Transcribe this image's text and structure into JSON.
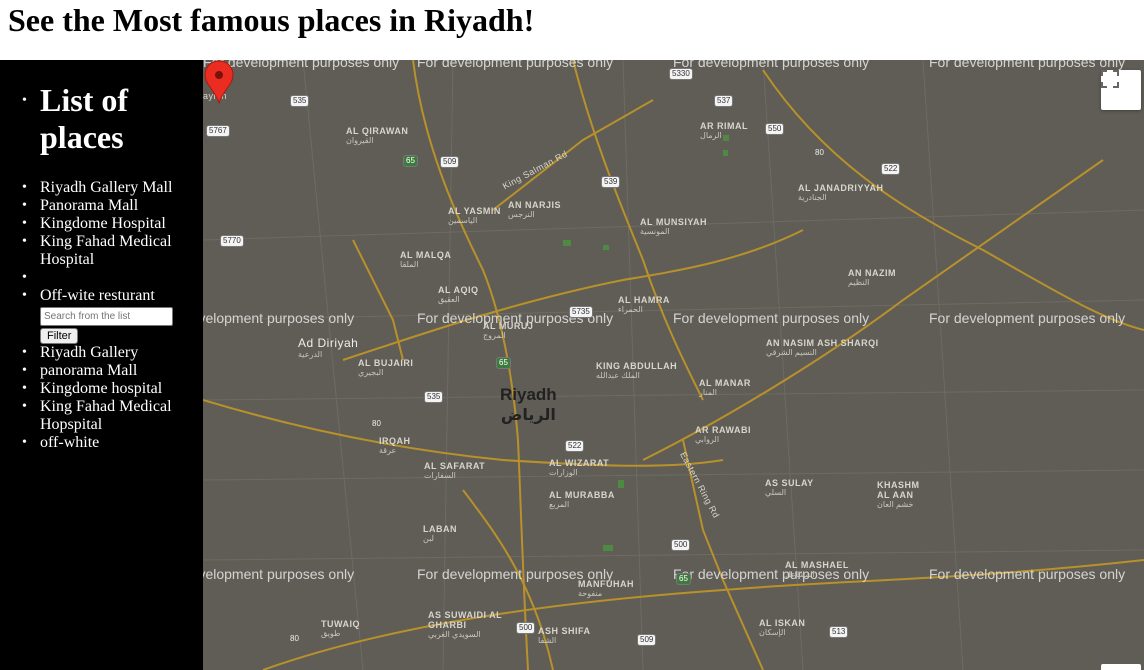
{
  "page": {
    "title": "See the Most famous places in Riyadh!"
  },
  "sidebar": {
    "heading": "List of places",
    "places": [
      "Riyadh Gallery Mall",
      "Panorama Mall",
      "Kingdome Hospital",
      "King Fahad Medical Hospital",
      "",
      "Off-wite resturant"
    ],
    "search_placeholder": "Search from the list",
    "filter_label": "Filter",
    "results": [
      "Riyadh Gallery",
      "panorama Mall",
      "Kingdome hospital",
      "King Fahad Medical Hopspital",
      "off-white"
    ]
  },
  "map": {
    "watermark": "For development purposes only",
    "city_en": "Riyadh",
    "city_ar": "الرياض",
    "districts": [
      {
        "en": "AL QIRAWAN",
        "ar": "القيروان"
      },
      {
        "en": "AN NARJIS",
        "ar": "النرجس"
      },
      {
        "en": "AL YASMIN",
        "ar": "الياسمين"
      },
      {
        "en": "AR RIMAL",
        "ar": "الرمال"
      },
      {
        "en": "AL JANADRIYYAH",
        "ar": "الجنادرية"
      },
      {
        "en": "AL MUNSIYAH",
        "ar": "المونسية"
      },
      {
        "en": "AL MALQA",
        "ar": "الملقا"
      },
      {
        "en": "AL AQIQ",
        "ar": "العقيق"
      },
      {
        "en": "AL HAMRA",
        "ar": "الحمراء"
      },
      {
        "en": "AN NAZIM",
        "ar": "النظيم"
      },
      {
        "en": "AL MURUJ",
        "ar": "المروج"
      },
      {
        "en": "Ad Diriyah",
        "ar": "الدرعية"
      },
      {
        "en": "AN NASIM ASH SHARQI",
        "ar": "النسيم الشرقي"
      },
      {
        "en": "AL BUJAIRI",
        "ar": "البجيري"
      },
      {
        "en": "KING ABDULLAH",
        "ar": "الملك عبدالله"
      },
      {
        "en": "AL MANAR",
        "ar": "المنار"
      },
      {
        "en": "IRQAH",
        "ar": "عرقة"
      },
      {
        "en": "AR RAWABI",
        "ar": "الروابي"
      },
      {
        "en": "AL SAFARAT",
        "ar": "السفارات"
      },
      {
        "en": "AL WIZARAT",
        "ar": "الوزارات"
      },
      {
        "en": "AS SULAY",
        "ar": "السلي"
      },
      {
        "en": "KHASHM AL AAN",
        "ar": "خشم العان"
      },
      {
        "en": "AL MURABBA",
        "ar": "المربع"
      },
      {
        "en": "LABAN",
        "ar": "لبن"
      },
      {
        "en": "AL MASHAEL",
        "ar": "المشاعل"
      },
      {
        "en": "MANFUHAH",
        "ar": "منفوحة"
      },
      {
        "en": "AS SUWAIDI AL GHARBI",
        "ar": "السويدي الغربي"
      },
      {
        "en": "TUWAIQ",
        "ar": "طويق"
      },
      {
        "en": "ASH SHIFA",
        "ar": "الشفا"
      },
      {
        "en": "AL ISKAN",
        "ar": "الإسكان"
      },
      {
        "en": "aylah",
        "ar": ""
      }
    ],
    "roads": [
      "King Salman Rd",
      "Eastern Ring Rd"
    ],
    "shields": [
      "535",
      "5767",
      "65",
      "509",
      "5330",
      "537",
      "550",
      "539",
      "80",
      "522",
      "5770",
      "5735",
      "65",
      "535",
      "80",
      "522",
      "500",
      "65",
      "500",
      "509",
      "513",
      "80"
    ],
    "colors": {
      "base": "#5f5d55",
      "road": "#b8912b",
      "marker": "#ea2c21"
    }
  }
}
